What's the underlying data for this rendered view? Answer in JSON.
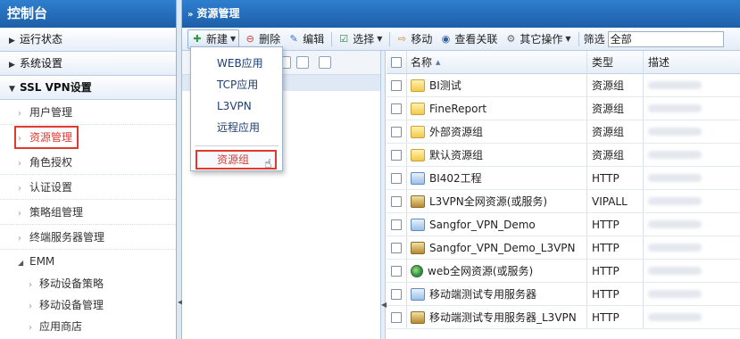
{
  "sidebar": {
    "title": "控制台",
    "sections": [
      {
        "label": "运行状态"
      },
      {
        "label": "系统设置"
      },
      {
        "label": "SSL VPN设置"
      }
    ],
    "subitems": [
      {
        "label": "用户管理"
      },
      {
        "label": "资源管理"
      },
      {
        "label": "角色授权"
      },
      {
        "label": "认证设置"
      },
      {
        "label": "策略组管理"
      },
      {
        "label": "终端服务器管理"
      }
    ],
    "emm": {
      "label": "EMM",
      "children": [
        {
          "label": "移动设备策略"
        },
        {
          "label": "移动设备管理"
        },
        {
          "label": "应用商店"
        }
      ]
    }
  },
  "main": {
    "title": "资源管理"
  },
  "toolbar": {
    "new_label": "新建",
    "delete_label": "删除",
    "edit_label": "编辑",
    "select_label": "选择",
    "move_label": "移动",
    "view_rel_label": "查看关联",
    "other_ops_label": "其它操作",
    "filter_label": "筛选",
    "filter_value": "全部"
  },
  "new_menu": {
    "items": [
      {
        "label": "WEB应用"
      },
      {
        "label": "TCP应用"
      },
      {
        "label": "L3VPN"
      },
      {
        "label": "远程应用"
      },
      {
        "label": "资源组"
      }
    ]
  },
  "grid": {
    "headers": {
      "name": "名称",
      "type": "类型",
      "desc": "描述"
    },
    "rows": [
      {
        "name": "BI测试",
        "type": "资源组",
        "icon": "folder-icon"
      },
      {
        "name": "FineReport",
        "type": "资源组",
        "icon": "folder-icon"
      },
      {
        "name": "外部资源组",
        "type": "资源组",
        "icon": "folder-icon"
      },
      {
        "name": "默认资源组",
        "type": "资源组",
        "icon": "folder-icon"
      },
      {
        "name": "BI402工程",
        "type": "HTTP",
        "icon": "web-app-icon"
      },
      {
        "name": "L3VPN全网资源(或服务)",
        "type": "VIPALL",
        "icon": "l3vpn-icon"
      },
      {
        "name": "Sangfor_VPN_Demo",
        "type": "HTTP",
        "icon": "web-app-icon"
      },
      {
        "name": "Sangfor_VPN_Demo_L3VPN",
        "type": "HTTP",
        "icon": "l3vpn-icon"
      },
      {
        "name": "web全网资源(或服务)",
        "type": "HTTP",
        "icon": "globe-icon"
      },
      {
        "name": "移动端测试专用服务器",
        "type": "HTTP",
        "icon": "web-app-icon"
      },
      {
        "name": "移动端测试专用服务器_L3VPN",
        "type": "HTTP",
        "icon": "l3vpn-icon"
      }
    ]
  }
}
